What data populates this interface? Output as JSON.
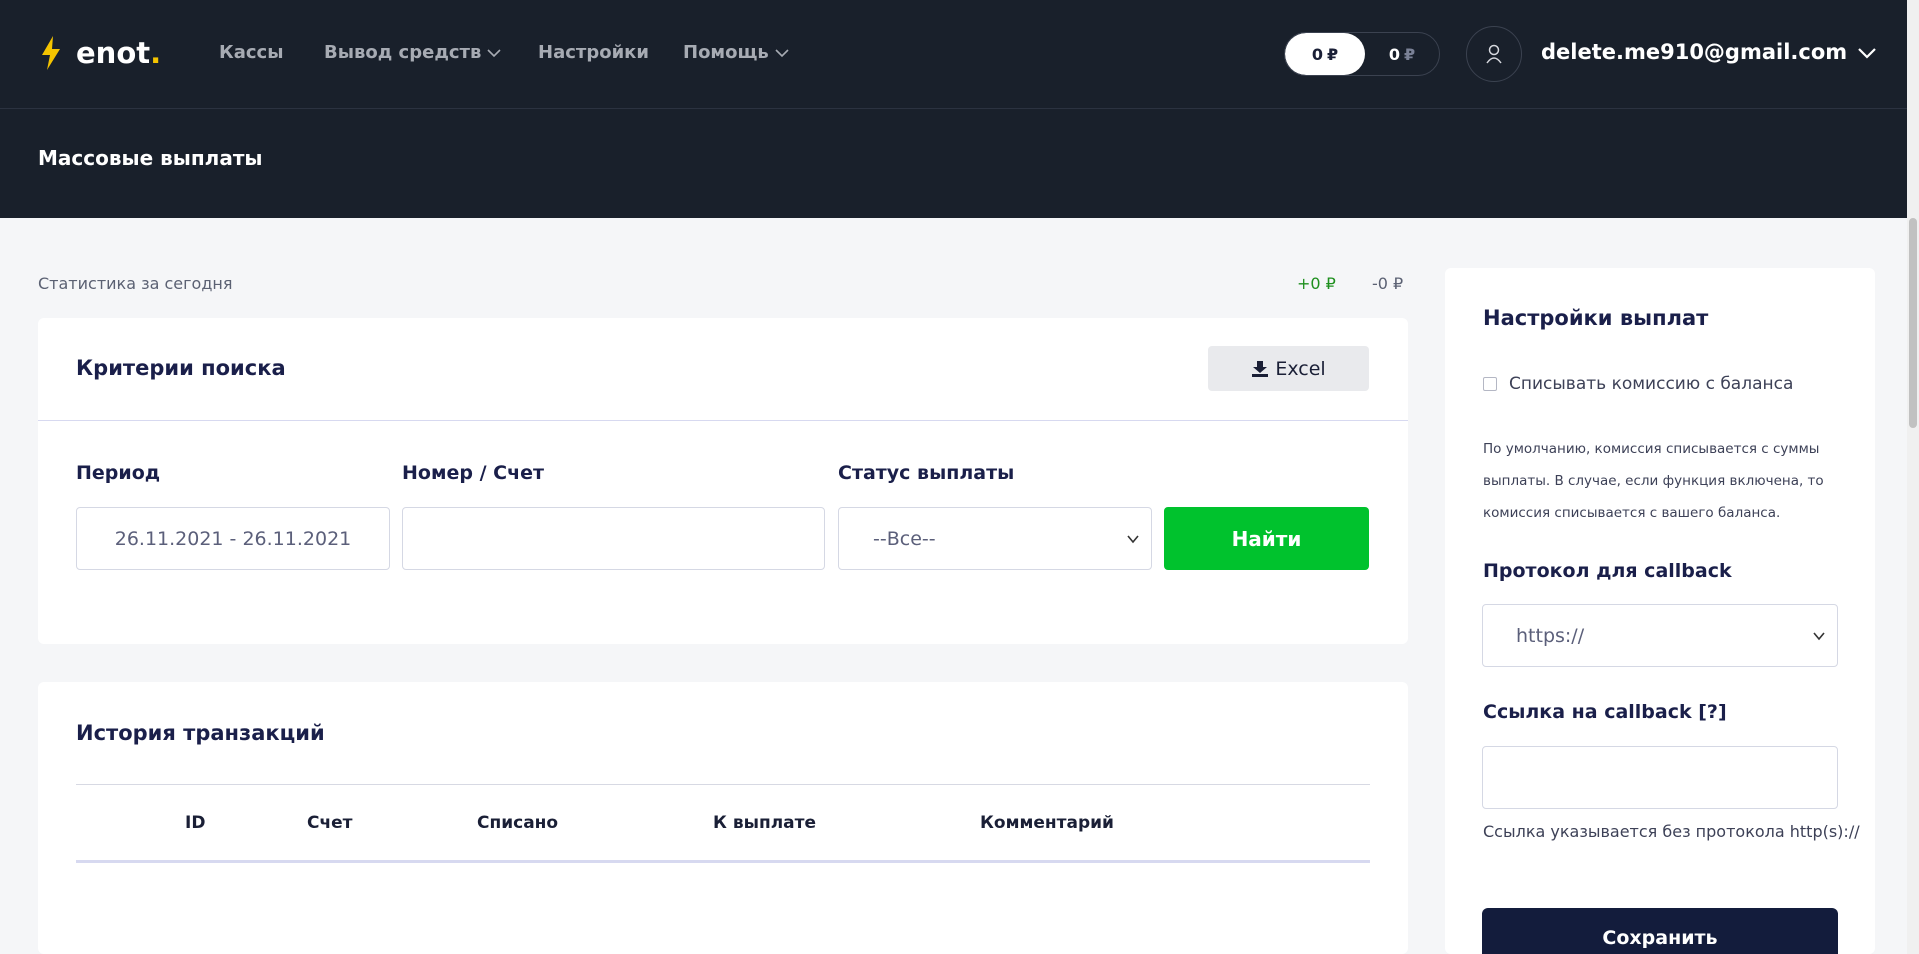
{
  "header": {
    "logo_text": "enot",
    "logo_dot": ".",
    "nav": [
      {
        "label": "Кассы"
      },
      {
        "label": "Вывод средств"
      },
      {
        "label": "Настройки"
      },
      {
        "label": "Помощь"
      }
    ],
    "balance_a": "0",
    "balance_b": "0",
    "currency": "₽",
    "email": "delete.me910@gmail.com",
    "page_title": "Массовые выплаты"
  },
  "stats": {
    "label": "Статистика за сегодня",
    "plus": "+0 ₽",
    "minus": "-0 ₽"
  },
  "search": {
    "title": "Критерии поиска",
    "excel_label": "Excel",
    "period_label": "Период",
    "period_value": "26.11.2021 - 26.11.2021",
    "number_label": "Номер / Счет",
    "number_value": "",
    "status_label": "Статус выплаты",
    "status_value": "--Все--",
    "find_label": "Найти"
  },
  "history": {
    "title": "История транзакций",
    "columns": [
      "ID",
      "Счет",
      "Списано",
      "К выплате",
      "Комментарий"
    ]
  },
  "settings": {
    "title": "Настройки выплат",
    "checkbox_label": "Списывать комиссию с баланса",
    "checkbox_checked": false,
    "hint": "По умолчанию, комиссия списывается с суммы выплаты. В случае, если функция включена, то комиссия списывается с вашего баланса.",
    "protocol_label": "Протокол для callback",
    "protocol_value": "https://",
    "callback_label": "Ссылка на callback [?]",
    "callback_value": "",
    "callback_note": "Ссылка указывается без протокола http(s)://",
    "save_label": "Сохранить"
  },
  "colors": {
    "header_bg": "#19202b",
    "accent_green": "#00c22d",
    "save_bg": "#131c3c",
    "logo_bolt": "#f5c400"
  }
}
